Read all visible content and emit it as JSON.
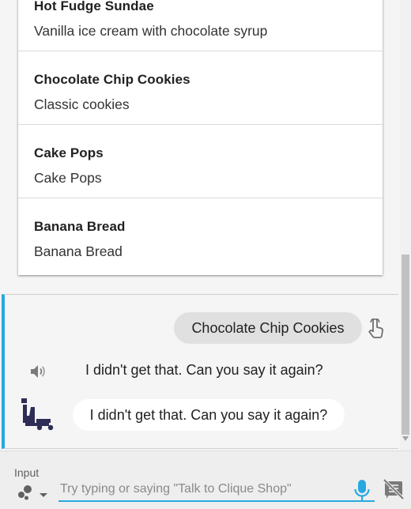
{
  "list": {
    "items": [
      {
        "title": "Hot Fudge Sundae",
        "description": "Vanilla ice cream with chocolate syrup"
      },
      {
        "title": "Chocolate Chip Cookies",
        "description": "Classic cookies"
      },
      {
        "title": "Cake Pops",
        "description": "Cake Pops"
      },
      {
        "title": "Banana Bread",
        "description": "Banana Bread"
      }
    ]
  },
  "turn": {
    "user_query": "Chocolate Chip Cookies",
    "speech_response": "I didn't get that. Can you say it again?",
    "display_response": "I didn't get that. Can you say it again?"
  },
  "input_bar": {
    "label": "Input",
    "placeholder": "Try typing or saying \"Talk to Clique Shop\"",
    "value": ""
  },
  "colors": {
    "accent": "#29a8e0",
    "avatar": "#2d2d55",
    "bubble_user": "#e0e0e0",
    "bubble_agent": "#ffffff"
  },
  "icons": [
    "touch-icon",
    "speaker-icon",
    "agent-avatar-icon",
    "input-mode-icon",
    "chevron-down-icon",
    "mic-icon",
    "no-display-icon"
  ]
}
